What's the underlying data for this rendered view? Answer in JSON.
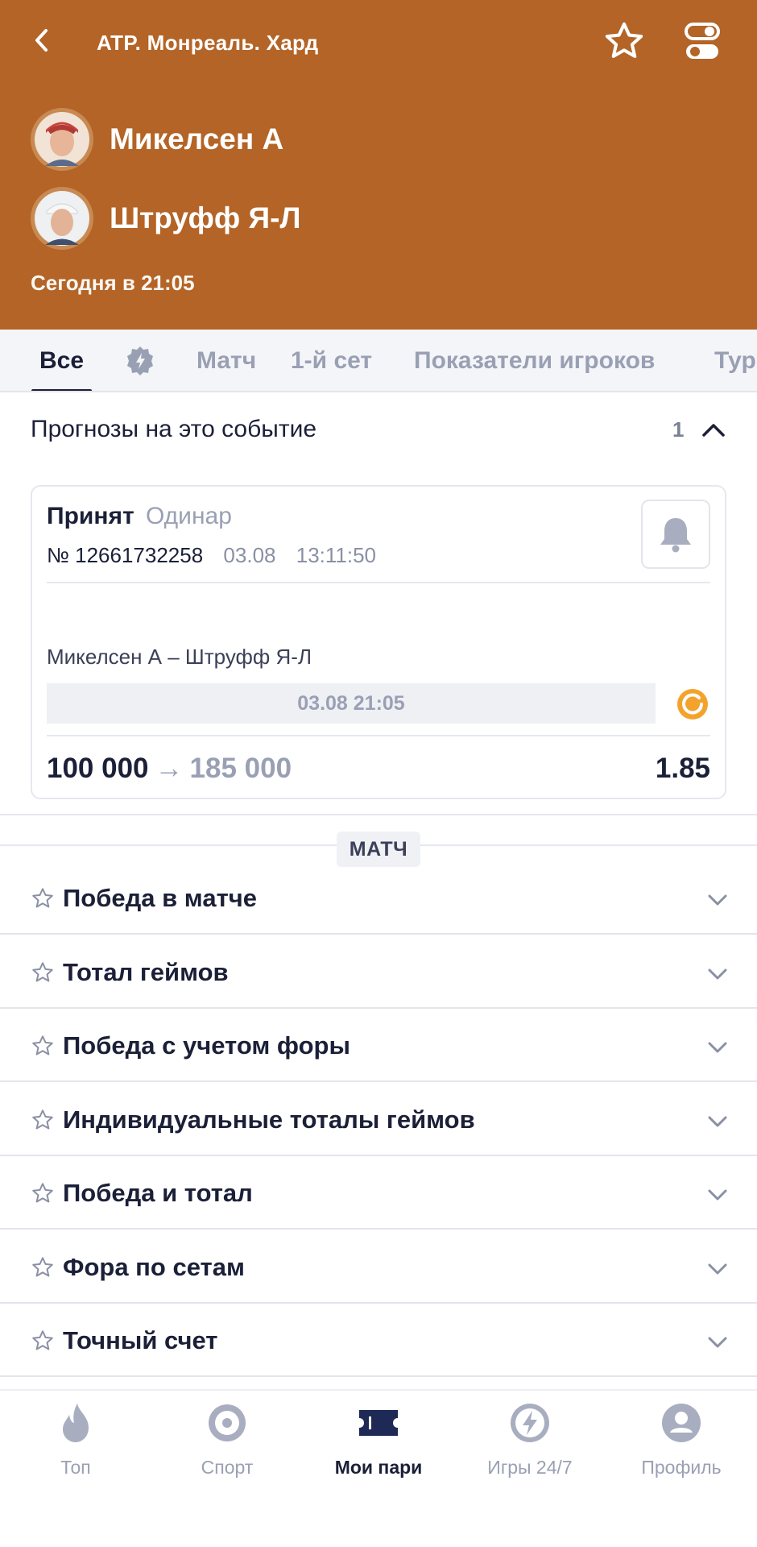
{
  "header": {
    "tournament": "ATP. Монреаль. Хард",
    "player1": "Микелсен А",
    "player2": "Штруфф Я-Л",
    "match_time": "Сегодня в 21:05",
    "bg_color": "#b36426"
  },
  "tabs": [
    {
      "label": "Все",
      "active": true
    },
    {
      "label": "Матч"
    },
    {
      "label": "1-й сет"
    },
    {
      "label": "Показатели игроков"
    },
    {
      "label": "Тур"
    }
  ],
  "predictions": {
    "title": "Прогнозы на это событие",
    "count": "1",
    "bet": {
      "status": "Принят",
      "type": "Одинар",
      "number": "№ 12661732258",
      "date": "03.08",
      "time": "13:11:50",
      "event": "Микелсен А – Штруфф Я-Л",
      "start": "03.08 21:05",
      "stake": "100 000",
      "arrow": "→",
      "win": "185 000",
      "odds": "1.85"
    }
  },
  "section": {
    "label": "МАТЧ"
  },
  "markets": [
    "Победа в матче",
    "Тотал геймов",
    "Победа с учетом форы",
    "Индивидуальные тоталы геймов",
    "Победа и тотал",
    "Фора по сетам",
    "Точный счет"
  ],
  "nav": [
    {
      "label": "Топ",
      "icon": "flame-icon"
    },
    {
      "label": "Спорт",
      "icon": "target-icon"
    },
    {
      "label": "Мои пари",
      "icon": "ticket-icon",
      "active": true
    },
    {
      "label": "Игры 24/7",
      "icon": "lightning-icon"
    },
    {
      "label": "Профиль",
      "icon": "user-icon"
    }
  ]
}
